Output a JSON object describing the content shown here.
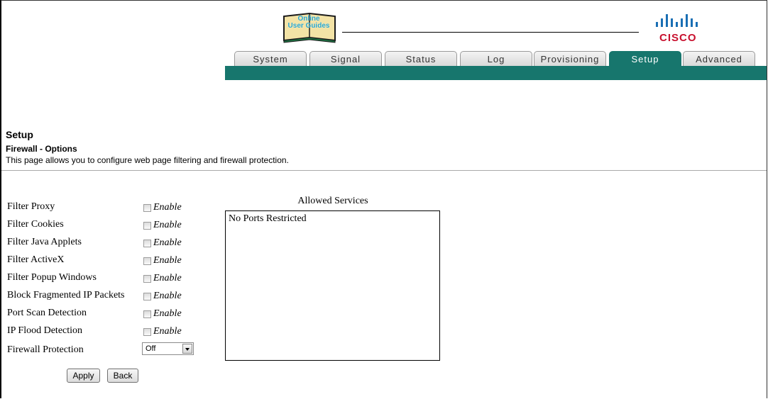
{
  "header": {
    "guide_logo_text_line1": "Online",
    "guide_logo_text_line2": "User Guides",
    "brand": "CISCO",
    "colors": {
      "teal": "#17766d",
      "cisco_red": "#c8102e",
      "cisco_blue": "#1a6fb4"
    }
  },
  "tabs": [
    {
      "label": "System",
      "active": false
    },
    {
      "label": "Signal",
      "active": false
    },
    {
      "label": "Status",
      "active": false
    },
    {
      "label": "Log",
      "active": false
    },
    {
      "label": "Provisioning",
      "active": false
    },
    {
      "label": "Setup",
      "active": true
    },
    {
      "label": "Advanced",
      "active": false
    }
  ],
  "page": {
    "title": "Setup",
    "section": "Firewall - Options",
    "description": "This page allows you to configure web page filtering and firewall protection."
  },
  "options": [
    {
      "label": "Filter Proxy",
      "enable_label": "Enable",
      "checked": false
    },
    {
      "label": "Filter Cookies",
      "enable_label": "Enable",
      "checked": false
    },
    {
      "label": "Filter Java Applets",
      "enable_label": "Enable",
      "checked": false
    },
    {
      "label": "Filter ActiveX",
      "enable_label": "Enable",
      "checked": false
    },
    {
      "label": "Filter Popup Windows",
      "enable_label": "Enable",
      "checked": false
    },
    {
      "label": "Block Fragmented IP Packets",
      "enable_label": "Enable",
      "checked": false
    },
    {
      "label": "Port Scan Detection",
      "enable_label": "Enable",
      "checked": false
    },
    {
      "label": "IP Flood Detection",
      "enable_label": "Enable",
      "checked": false
    }
  ],
  "firewall_protection": {
    "label": "Firewall Protection",
    "value": "Off"
  },
  "buttons": {
    "apply": "Apply",
    "back": "Back"
  },
  "allowed_services": {
    "title": "Allowed Services",
    "items": [
      "No Ports Restricted"
    ]
  }
}
